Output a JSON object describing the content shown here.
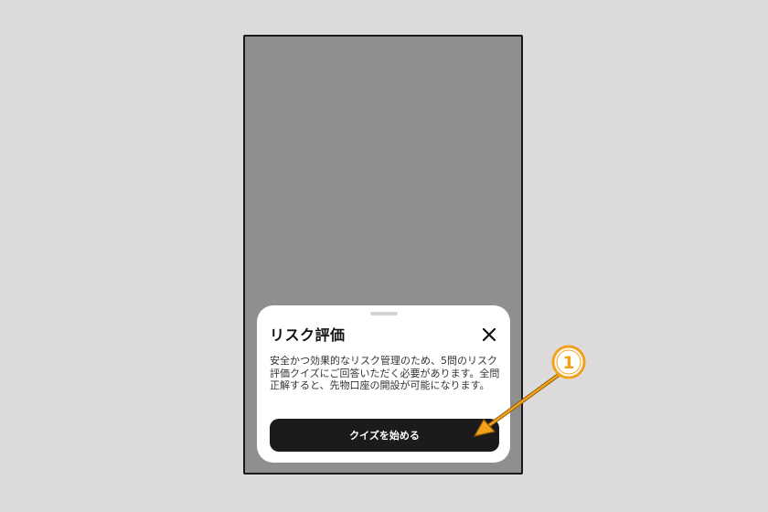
{
  "sheet": {
    "title": "リスク評価",
    "description": "安全かつ効果的なリスク管理のため、5問のリスク評価クイズにご回答いただく必要があります。全問正解すると、先物口座の開設が可能になります。",
    "cta_label": "クイズを始める"
  },
  "annotation": {
    "marker_label": "1",
    "color": "#f2a21a"
  }
}
